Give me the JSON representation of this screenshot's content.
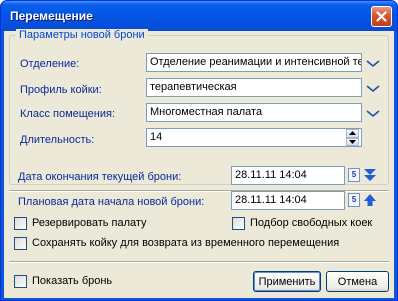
{
  "window": {
    "title": "Перемещение"
  },
  "group": {
    "title": "Параметры новой брони",
    "department_label": "Отделение:",
    "department_value": "Отделение реанимации и интенсивной те",
    "bed_profile_label": "Профиль койки:",
    "bed_profile_value": "терапевтическая",
    "room_class_label": "Класс помещения:",
    "room_class_value": "Многоместная палата",
    "duration_label": "Длительность:",
    "duration_value": "14"
  },
  "dates": {
    "end_current_label": "Дата окончания текущей брони:",
    "end_current_value": "28.11.11 14:04",
    "start_new_label": "Плановая дата начала новой брони:",
    "start_new_value": "28.11.11 14:04",
    "calendar_glyph": "5"
  },
  "options": {
    "reserve_room": "Резервировать палату",
    "free_beds": "Подбор свободных коек",
    "keep_bed": "Сохранять койку для возврата из временного перемещения",
    "show_booking": "Показать бронь"
  },
  "buttons": {
    "apply": "Применить",
    "cancel": "Отмена"
  },
  "colors": {
    "title_bar": "#0256e6",
    "label_blue": "#0a2a9a",
    "group_title": "#0046d5",
    "dialog_bg": "#ece9d8"
  }
}
